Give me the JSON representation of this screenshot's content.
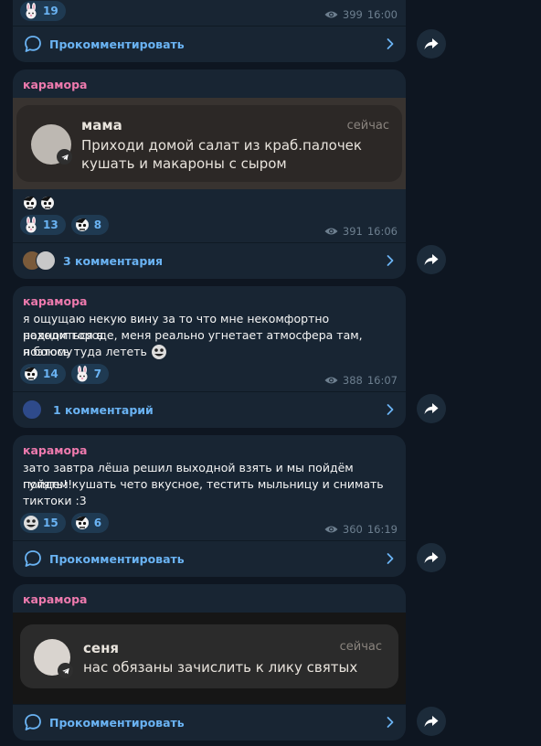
{
  "post_top": {
    "reaction_count": "19",
    "views": "399",
    "time": "16:00",
    "comment_label": "Прокомментировать"
  },
  "post2": {
    "author": "карамора",
    "notification": {
      "sender": "мама",
      "time": "сейчас",
      "text_line1": "Приходи домой салат из краб.палочек",
      "text_line2": "кушать и макароны с сыром"
    },
    "reactions": [
      "13",
      "8"
    ],
    "views": "391",
    "time": "16:06",
    "comment_label": "3 комментария"
  },
  "post3": {
    "author": "карамора",
    "text_line1": "я ощущаю некую вину за то что мне некомфортно находиться в",
    "text_line2": "родном городе, меня реально угнетает атмосфера там, поэтому",
    "text_line3": "я боюсь туда лететь",
    "reactions": [
      "14",
      "7"
    ],
    "views": "388",
    "time": "16:07",
    "comment_label": "1 комментарий"
  },
  "post4": {
    "author": "карамора",
    "text_line1": "зато завтра лёша решил выходной взять и мы пойдём гулять!!",
    "text_line2": "пойдем кушать чето вкусное, тестить мыльницу и снимать",
    "text_line3": "тиктоки :3",
    "reactions": [
      "15",
      "6"
    ],
    "views": "360",
    "time": "16:19",
    "comment_label": "Прокомментировать"
  },
  "post5": {
    "author": "карамора",
    "notification": {
      "sender": "сеня",
      "time": "сейчас",
      "text": "нас обязаны зачислить к лику святых"
    },
    "comment_label": "Прокомментировать"
  },
  "colors": {
    "background": "#0e1621",
    "bubble": "#182533",
    "accent": "#6ab3f3",
    "author": "#ee7aae",
    "meta": "#6d7f8f"
  },
  "icons": [
    "bunny-emoji-icon",
    "skull-emoji-icon",
    "eye-icon",
    "comment-bubble-icon",
    "chevron-right-icon",
    "share-arrow-icon",
    "telegram-icon"
  ]
}
